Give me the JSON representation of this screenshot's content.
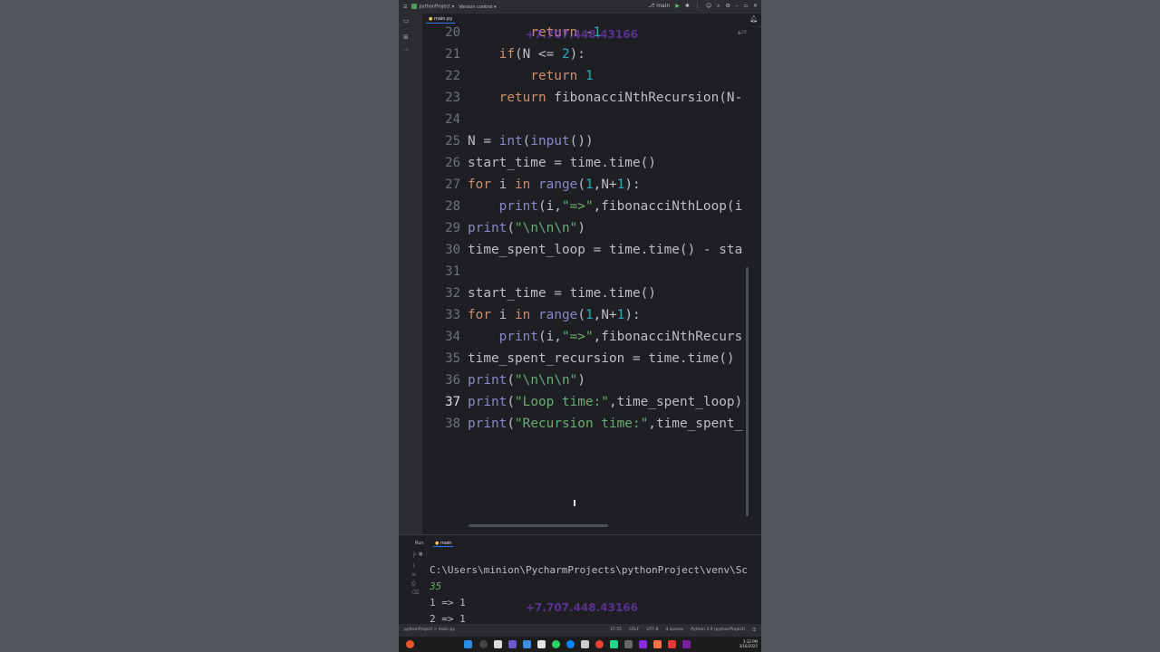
{
  "titlebar": {
    "project": "pythonProject",
    "vcs": "Version control",
    "branch": "main"
  },
  "editor_tab": {
    "label": "main.py"
  },
  "inspection": {
    "label": "▲28"
  },
  "code_lines": [
    {
      "num": "20",
      "tokens": [
        {
          "t": "        ",
          "c": "plain"
        },
        {
          "t": "return",
          "c": "kw"
        },
        {
          "t": " -",
          "c": "plain"
        },
        {
          "t": "1",
          "c": "num"
        }
      ]
    },
    {
      "num": "21",
      "tokens": [
        {
          "t": "    ",
          "c": "plain"
        },
        {
          "t": "if",
          "c": "kw"
        },
        {
          "t": "(N <= ",
          "c": "plain"
        },
        {
          "t": "2",
          "c": "num"
        },
        {
          "t": "):",
          "c": "plain"
        }
      ]
    },
    {
      "num": "22",
      "tokens": [
        {
          "t": "        ",
          "c": "plain"
        },
        {
          "t": "return",
          "c": "kw"
        },
        {
          "t": " ",
          "c": "plain"
        },
        {
          "t": "1",
          "c": "num"
        }
      ]
    },
    {
      "num": "23",
      "tokens": [
        {
          "t": "    ",
          "c": "plain"
        },
        {
          "t": "return",
          "c": "kw"
        },
        {
          "t": " fibonacciNthRecursion(N-",
          "c": "plain"
        }
      ]
    },
    {
      "num": "24",
      "tokens": []
    },
    {
      "num": "25",
      "tokens": [
        {
          "t": "N = ",
          "c": "plain"
        },
        {
          "t": "int",
          "c": "bi"
        },
        {
          "t": "(",
          "c": "plain"
        },
        {
          "t": "input",
          "c": "bi"
        },
        {
          "t": "())",
          "c": "plain"
        }
      ]
    },
    {
      "num": "26",
      "tokens": [
        {
          "t": "start_time = time.time()",
          "c": "plain"
        }
      ]
    },
    {
      "num": "27",
      "tokens": [
        {
          "t": "for",
          "c": "kw"
        },
        {
          "t": " i ",
          "c": "plain"
        },
        {
          "t": "in",
          "c": "kw"
        },
        {
          "t": " ",
          "c": "plain"
        },
        {
          "t": "range",
          "c": "bi"
        },
        {
          "t": "(",
          "c": "plain"
        },
        {
          "t": "1",
          "c": "num"
        },
        {
          "t": ",N+",
          "c": "plain"
        },
        {
          "t": "1",
          "c": "num"
        },
        {
          "t": "):",
          "c": "plain"
        }
      ]
    },
    {
      "num": "28",
      "tokens": [
        {
          "t": "    ",
          "c": "plain"
        },
        {
          "t": "print",
          "c": "bi"
        },
        {
          "t": "(i,",
          "c": "plain"
        },
        {
          "t": "\"=>\"",
          "c": "str"
        },
        {
          "t": ",fibonacciNthLoop(i",
          "c": "plain"
        }
      ]
    },
    {
      "num": "29",
      "tokens": [
        {
          "t": "print",
          "c": "bi"
        },
        {
          "t": "(",
          "c": "plain"
        },
        {
          "t": "\"\\n\\n\\n\"",
          "c": "str"
        },
        {
          "t": ")",
          "c": "plain"
        }
      ]
    },
    {
      "num": "30",
      "tokens": [
        {
          "t": "time_spent_loop = time.time() - sta",
          "c": "plain"
        }
      ]
    },
    {
      "num": "31",
      "tokens": []
    },
    {
      "num": "32",
      "tokens": [
        {
          "t": "start_time = time.time()",
          "c": "plain"
        }
      ]
    },
    {
      "num": "33",
      "tokens": [
        {
          "t": "for",
          "c": "kw"
        },
        {
          "t": " i ",
          "c": "plain"
        },
        {
          "t": "in",
          "c": "kw"
        },
        {
          "t": " ",
          "c": "plain"
        },
        {
          "t": "range",
          "c": "bi"
        },
        {
          "t": "(",
          "c": "plain"
        },
        {
          "t": "1",
          "c": "num"
        },
        {
          "t": ",N+",
          "c": "plain"
        },
        {
          "t": "1",
          "c": "num"
        },
        {
          "t": "):",
          "c": "plain"
        }
      ]
    },
    {
      "num": "34",
      "tokens": [
        {
          "t": "    ",
          "c": "plain"
        },
        {
          "t": "print",
          "c": "bi"
        },
        {
          "t": "(i,",
          "c": "plain"
        },
        {
          "t": "\"=>\"",
          "c": "str"
        },
        {
          "t": ",fibonacciNthRecurs",
          "c": "plain"
        }
      ]
    },
    {
      "num": "35",
      "tokens": [
        {
          "t": "time_spent_recursion = time.time()",
          "c": "plain"
        }
      ]
    },
    {
      "num": "36",
      "tokens": [
        {
          "t": "print",
          "c": "bi"
        },
        {
          "t": "(",
          "c": "plain"
        },
        {
          "t": "\"\\n\\n\\n\"",
          "c": "str"
        },
        {
          "t": ")",
          "c": "plain"
        }
      ]
    },
    {
      "num": "37",
      "active": true,
      "tokens": [
        {
          "t": "print",
          "c": "bi"
        },
        {
          "t": "(",
          "c": "plain"
        },
        {
          "t": "\"Loop time:\"",
          "c": "str"
        },
        {
          "t": ",time_spent_loop)",
          "c": "plain"
        }
      ]
    },
    {
      "num": "38",
      "tokens": [
        {
          "t": "print",
          "c": "bi"
        },
        {
          "t": "(",
          "c": "plain"
        },
        {
          "t": "\"Recursion time:\"",
          "c": "str"
        },
        {
          "t": ",time_spent_",
          "c": "plain"
        }
      ]
    }
  ],
  "run_panel": {
    "title": "Run",
    "config": "main",
    "console_lines": [
      {
        "text": "C:\\Users\\minion\\PycharmProjects\\pythonProject\\venv\\Sc",
        "kind": "plain"
      },
      {
        "text": "35",
        "kind": "input"
      },
      {
        "text": "1 => 1",
        "kind": "plain"
      },
      {
        "text": "2 => 1",
        "kind": "plain"
      }
    ]
  },
  "watermark": {
    "text": "+7.707.448.43166"
  },
  "statusbar": {
    "breadcrumb": "pythonProject > main.py",
    "position": "37:55",
    "line_sep": "CRLF",
    "encoding": "UTF-8",
    "indent": "4 spaces",
    "interpreter": "Python 3.9 (pythonProject)"
  },
  "taskbar": {
    "time": "3:32 PM",
    "date": "3/16/2025"
  },
  "colors": {
    "keyword": "#cf8e6d",
    "string": "#6aab73",
    "number": "#2aacb8",
    "builtin": "#8888c6",
    "text": "#bcbec4",
    "accent": "#3574f0"
  }
}
